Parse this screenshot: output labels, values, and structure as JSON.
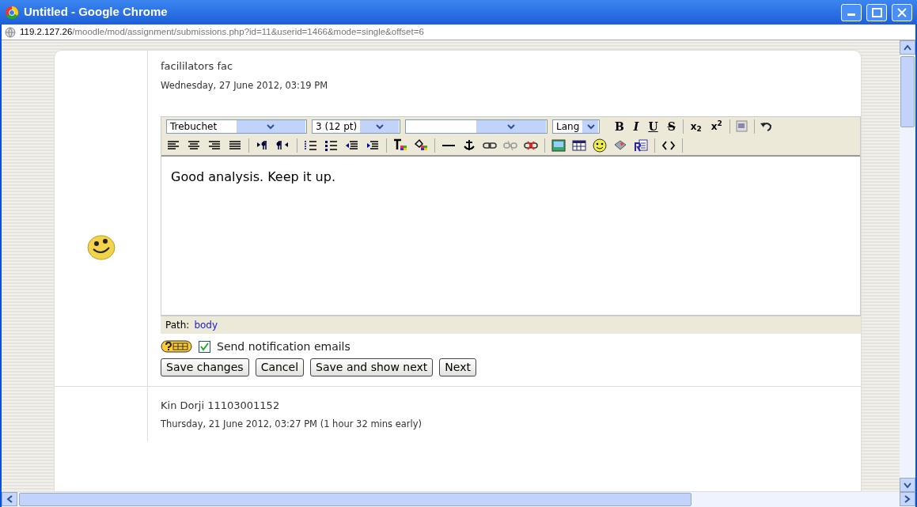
{
  "window": {
    "title": "Untitled - Google Chrome"
  },
  "address_bar": {
    "host": "119.2.127.26",
    "path": "/moodle/mod/assignment/submissions.php?id=11&userid=1466&mode=single&offset=6"
  },
  "feedback": {
    "author": "facililators fac",
    "date": "Wednesday, 27 June 2012, 03:19 PM",
    "editor": {
      "selects": [
        {
          "kind": "font",
          "value": "Trebuchet"
        },
        {
          "kind": "size",
          "value": "3 (12 pt)"
        },
        {
          "kind": "style"
        },
        {
          "kind": "lang",
          "value": "Lang"
        }
      ],
      "row1": [
        {
          "kind": "bold",
          "label": "B"
        },
        {
          "kind": "italic",
          "label": "I"
        },
        {
          "kind": "underline",
          "label": "U"
        },
        {
          "kind": "strike",
          "label": "S"
        },
        {
          "kind": "sep"
        },
        {
          "kind": "sub",
          "label": "x",
          "sub": "2"
        },
        {
          "kind": "sup",
          "label": "x",
          "sub": "2"
        },
        {
          "kind": "sep"
        },
        {
          "kind": "word"
        },
        {
          "kind": "sep"
        },
        {
          "kind": "undo"
        }
      ],
      "row2": [
        {
          "kind": "align-left"
        },
        {
          "kind": "align-center"
        },
        {
          "kind": "align-right"
        },
        {
          "kind": "justify"
        },
        {
          "kind": "sep"
        },
        {
          "kind": "ltr"
        },
        {
          "kind": "rtl"
        },
        {
          "kind": "sep"
        },
        {
          "kind": "ol"
        },
        {
          "kind": "ul"
        },
        {
          "kind": "outdent"
        },
        {
          "kind": "indent"
        },
        {
          "kind": "sep"
        },
        {
          "kind": "forecolor"
        },
        {
          "kind": "backcolor"
        },
        {
          "kind": "sep"
        },
        {
          "kind": "hr"
        },
        {
          "kind": "anchor"
        },
        {
          "kind": "link"
        },
        {
          "kind": "unlink"
        },
        {
          "kind": "nolink"
        },
        {
          "kind": "sep"
        },
        {
          "kind": "image"
        },
        {
          "kind": "table"
        },
        {
          "kind": "smiley"
        },
        {
          "kind": "char"
        },
        {
          "kind": "replace"
        },
        {
          "kind": "sep"
        },
        {
          "kind": "code"
        },
        {
          "kind": "sep"
        }
      ],
      "content": "Good analysis. Keep it up.",
      "path_label": "Path:",
      "path_link": "body"
    },
    "notify": {
      "label": "Send notification emails",
      "checked": true
    },
    "buttons": [
      "Save changes",
      "Cancel",
      "Save and show next",
      "Next"
    ]
  },
  "submission": {
    "author": "Kin Dorji 11103001152",
    "date": "Thursday, 21 June 2012, 03:27 PM (1 hour 32 mins early)"
  }
}
